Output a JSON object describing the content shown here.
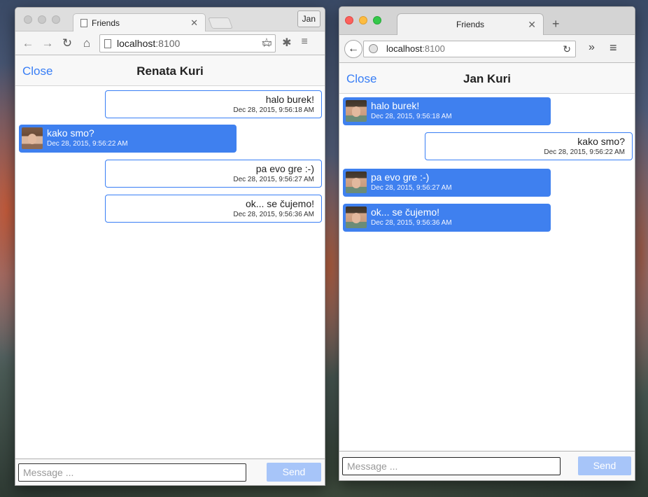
{
  "window_left": {
    "tab_title": "Friends",
    "profile_name": "Jan",
    "url_host": "localhost",
    "url_port": ":8100",
    "header": {
      "close_label": "Close",
      "title": "Renata Kuri"
    },
    "messages": [
      {
        "text": "halo burek!",
        "time": "Dec 28, 2015, 9:56:18 AM",
        "mine": true
      },
      {
        "text": "kako smo?",
        "time": "Dec 28, 2015, 9:56:22 AM",
        "mine": false
      },
      {
        "text": "pa evo gre :-)",
        "time": "Dec 28, 2015, 9:56:27 AM",
        "mine": true
      },
      {
        "text": "ok... se čujemo!",
        "time": "Dec 28, 2015, 9:56:36 AM",
        "mine": true
      }
    ],
    "footer": {
      "placeholder": "Message ...",
      "send_label": "Send"
    }
  },
  "window_right": {
    "tab_title": "Friends",
    "url_host": "localhost",
    "url_port": ":8100",
    "header": {
      "close_label": "Close",
      "title": "Jan Kuri"
    },
    "messages": [
      {
        "text": "halo burek!",
        "time": "Dec 28, 2015, 9:56:18 AM",
        "mine": false
      },
      {
        "text": "kako smo?",
        "time": "Dec 28, 2015, 9:56:22 AM",
        "mine": true
      },
      {
        "text": "pa evo gre :-)",
        "time": "Dec 28, 2015, 9:56:27 AM",
        "mine": false
      },
      {
        "text": "ok... se čujemo!",
        "time": "Dec 28, 2015, 9:56:36 AM",
        "mine": false
      }
    ],
    "footer": {
      "placeholder": "Message ...",
      "send_label": "Send"
    }
  },
  "colors": {
    "accent": "#387ef5",
    "bubble_theirs": "#3f80ef",
    "send_disabled": "#a7c5f9",
    "mac_close": "#fc605c",
    "mac_min": "#fdbc40",
    "mac_max": "#34c84a"
  }
}
